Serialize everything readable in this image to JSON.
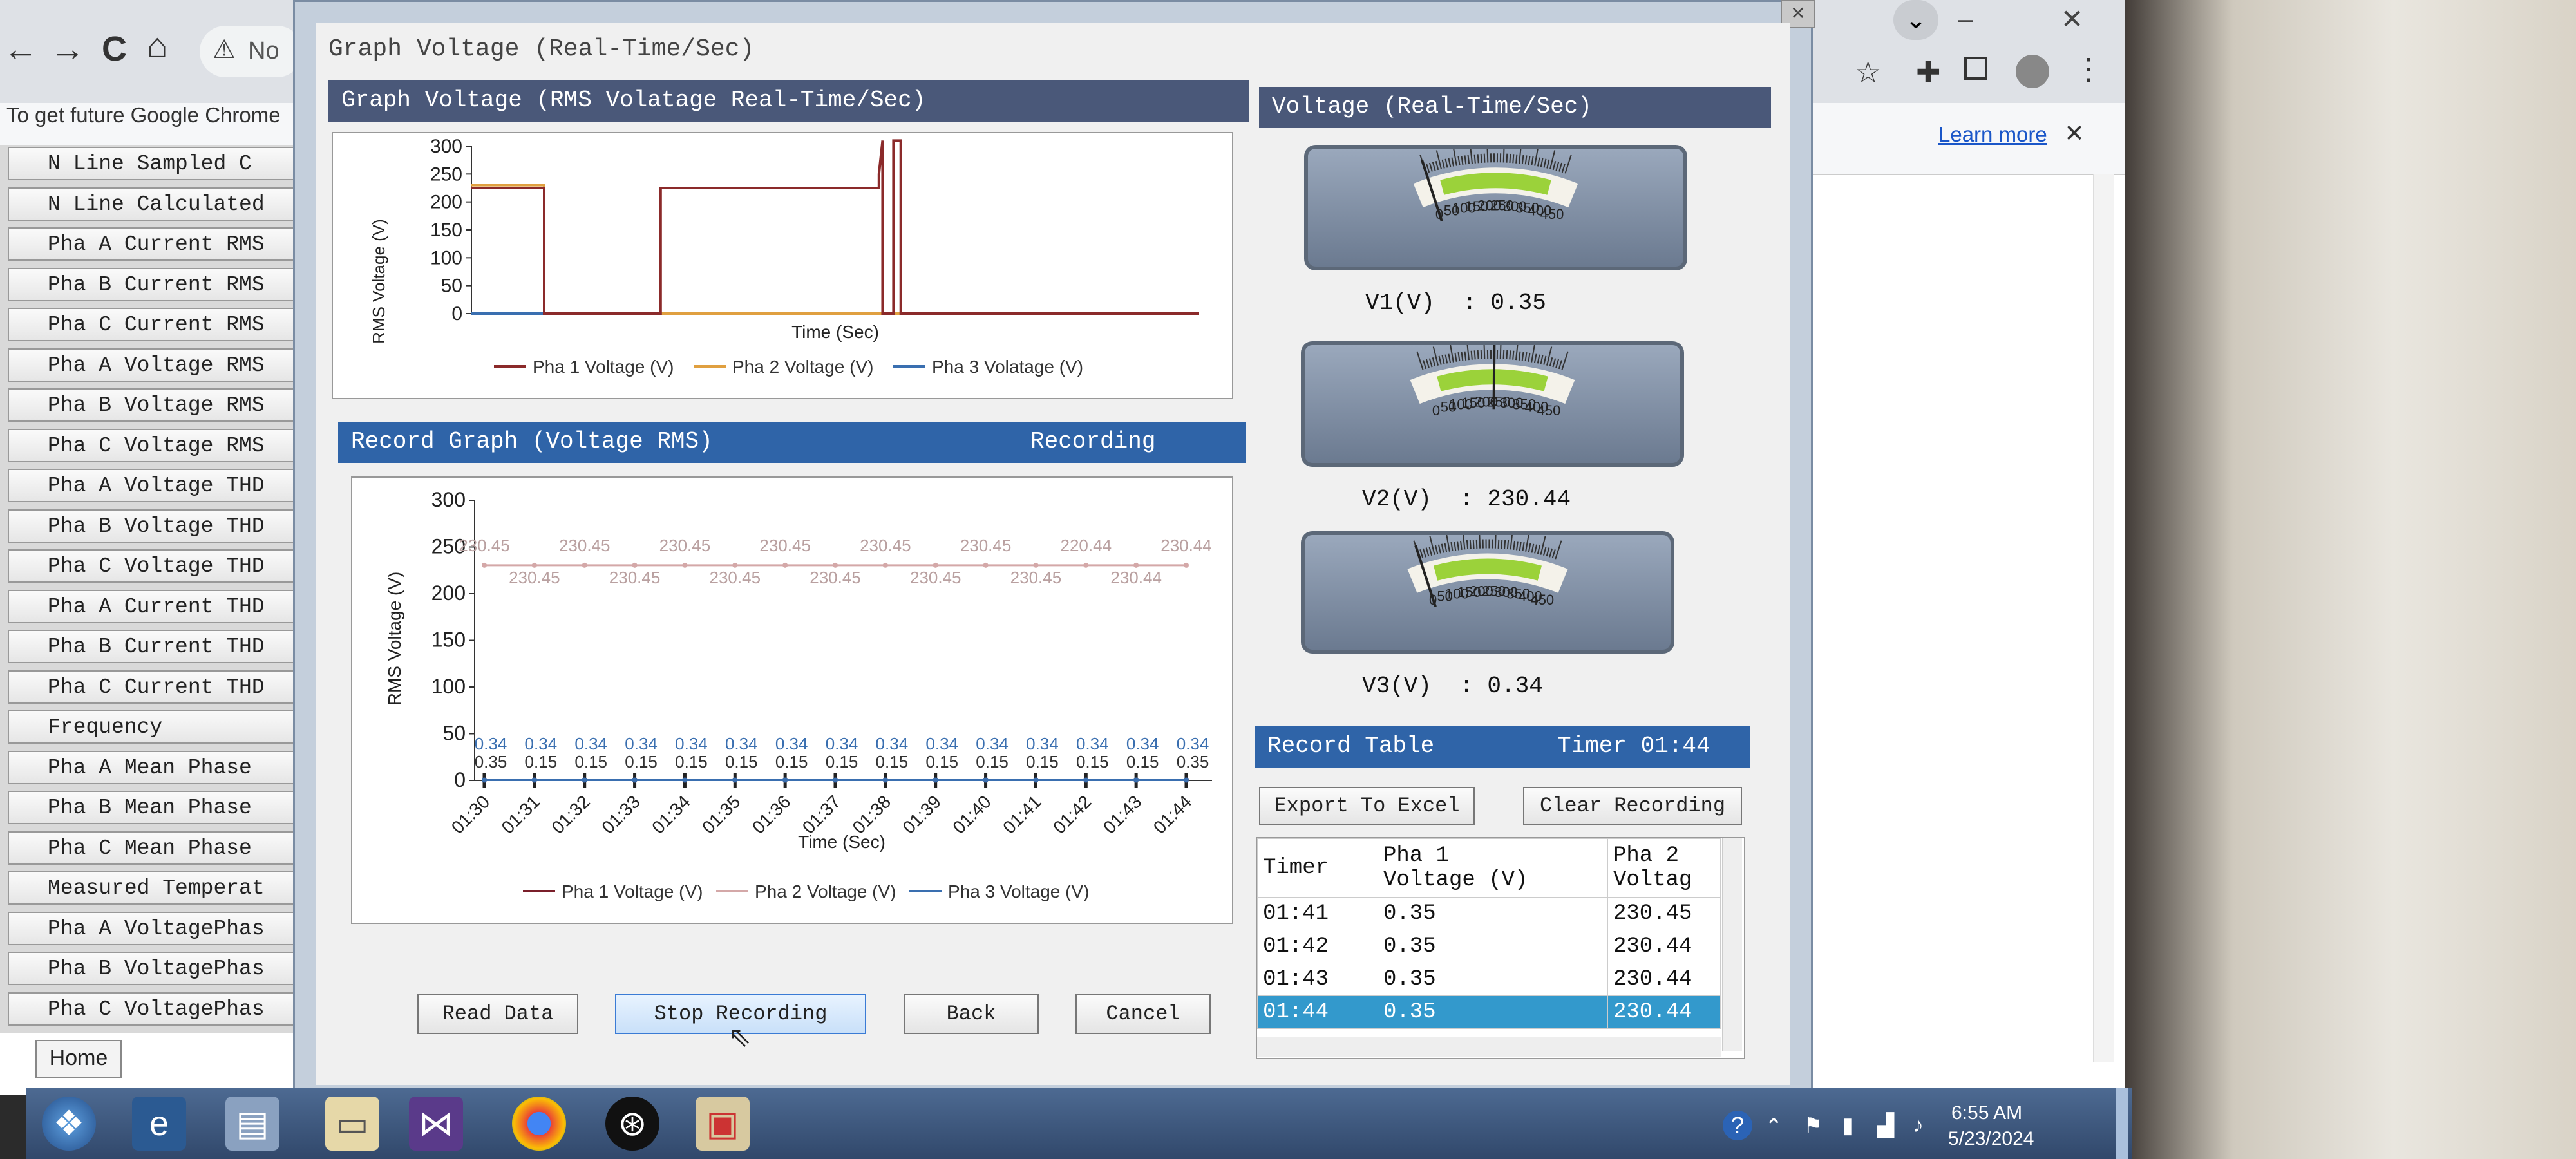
{
  "browser": {
    "nav": {
      "back": "←",
      "forward": "→",
      "reload": "C",
      "home": "⌂"
    },
    "address_prefix": "No",
    "infobar_text": "To get future Google Chrome",
    "learn_more": "Learn more",
    "close": "✕"
  },
  "app_list": {
    "items": [
      "N Line Sampled C",
      "N Line Calculated",
      "Pha A Current RMS",
      "Pha B Current RMS",
      "Pha C Current RMS",
      "Pha A Voltage RMS",
      "Pha B Voltage RMS",
      "Pha C Voltage RMS",
      "Pha A Voltage THD",
      "Pha B Voltage THD",
      "Pha C Voltage THD",
      "Pha A Current THD",
      "Pha B Current THD",
      "Pha C Current THD",
      "Frequency",
      "Pha A Mean Phase",
      "Pha B Mean Phase",
      "Pha C Mean Phase",
      "Measured Temperat",
      "Pha A VoltagePhas",
      "Pha B VoltagePhas",
      "Pha C VoltagePhas"
    ],
    "home_button": "Home"
  },
  "dialog": {
    "group_title": "Graph Voltage (Real-Time/Sec)",
    "close_glyph": "✕",
    "live_chart_header": "Graph Voltage (RMS Volatage Real-Time/Sec)",
    "record_header": "Record Graph (Voltage RMS)",
    "record_status": "Recording",
    "gauges_header": "Voltage (Real-Time/Sec)",
    "gauges": [
      {
        "label": "V1(V)  : 0.35",
        "value": 0.35
      },
      {
        "label": "V2(V)  : 230.44",
        "value": 230.44
      },
      {
        "label": "V3(V)  : 0.34",
        "value": 0.34
      }
    ],
    "gauge_scale": [
      "0",
      "50",
      "100",
      "150",
      "200",
      "250",
      "300",
      "350",
      "400",
      "450"
    ],
    "record_table_header": "Record Table",
    "timer_label": "Timer 01:44",
    "export_button": "Export To Excel",
    "clear_button": "Clear Recording",
    "table": {
      "headers": [
        "Timer",
        "Pha 1\nVoltage (V)",
        "Pha 2\nVoltag"
      ],
      "rows": [
        [
          "01:41",
          "0.35",
          "230.45"
        ],
        [
          "01:42",
          "0.35",
          "230.44"
        ],
        [
          "01:43",
          "0.35",
          "230.44"
        ],
        [
          "01:44",
          "0.35",
          "230.44"
        ]
      ],
      "selected_row": 3
    },
    "buttons": {
      "read": "Read Data",
      "stop": "Stop Recording",
      "back": "Back",
      "cancel": "Cancel"
    }
  },
  "taskbar": {
    "time": "6:55 AM",
    "date": "5/23/2024",
    "help": "?",
    "tray_up": "⌃"
  },
  "chart_data": [
    {
      "type": "line",
      "xlabel": "Time (Sec)",
      "ylabel": "RMS Voltage (V)",
      "ylim": [
        0,
        300
      ],
      "yticks": [
        "0",
        "50",
        "100",
        "150",
        "200",
        "250",
        "300"
      ],
      "series": [
        {
          "name": "Pha 1 Voltage (V)",
          "color": "#8b2a2a",
          "points": [
            [
              0,
              225
            ],
            [
              0.1,
              225
            ],
            [
              0.1,
              0
            ],
            [
              0.26,
              0
            ],
            [
              0.26,
              225
            ],
            [
              0.56,
              225
            ],
            [
              0.56,
              250
            ],
            [
              0.565,
              310
            ],
            [
              0.565,
              0
            ],
            [
              0.58,
              0
            ],
            [
              0.58,
              310
            ],
            [
              0.59,
              310
            ],
            [
              0.59,
              0
            ],
            [
              1,
              0
            ]
          ]
        },
        {
          "name": "Pha 2 Voltage (V)",
          "color": "#e0a040",
          "points": [
            [
              0,
              230
            ],
            [
              0.1,
              230
            ],
            [
              0.1,
              0
            ],
            [
              1,
              0
            ]
          ]
        },
        {
          "name": "Pha 3 Volatage (V)",
          "color": "#3a6fb0",
          "points": [
            [
              0,
              0
            ],
            [
              1,
              0
            ]
          ]
        }
      ],
      "legend": "bottom"
    },
    {
      "type": "line",
      "xlabel": "Time (Sec)",
      "ylabel": "RMS Voltage (V)",
      "ylim": [
        0,
        300
      ],
      "yticks": [
        "0",
        "50",
        "100",
        "150",
        "200",
        "250",
        "300"
      ],
      "categories": [
        "01:30",
        "01:31",
        "01:32",
        "01:33",
        "01:34",
        "01:35",
        "01:36",
        "01:37",
        "01:38",
        "01:39",
        "01:40",
        "01:41",
        "01:42",
        "01:43",
        "01:44"
      ],
      "series": [
        {
          "name": "Pha 1 Voltage (V)",
          "color": "#7a1f2a",
          "values": [
            0.35,
            0.35,
            0.35,
            0.35,
            0.35,
            0.35,
            0.35,
            0.35,
            0.35,
            0.35,
            0.35,
            0.35,
            0.35,
            0.35,
            0.35
          ]
        },
        {
          "name": "Pha 2 Voltage (V)",
          "color": "#d4a8a8",
          "values": [
            230.45,
            230.45,
            230.45,
            230.45,
            230.45,
            230.45,
            230.45,
            230.45,
            230.45,
            230.45,
            230.45,
            230.45,
            230.45,
            230.44,
            230.44
          ]
        },
        {
          "name": "Pha 3 Voltage (V)",
          "color": "#3a6fb0",
          "values": [
            0.34,
            0.34,
            0.34,
            0.34,
            0.34,
            0.34,
            0.34,
            0.34,
            0.34,
            0.34,
            0.34,
            0.34,
            0.34,
            0.34,
            0.34
          ]
        }
      ],
      "pha2_labels": [
        "230.45",
        "230.45",
        "230.45",
        "230.45",
        "230.45",
        "230.45",
        "230.45",
        "230.45",
        "230.45",
        "230.45",
        "230.45",
        "230.45",
        "220.44",
        "230.44",
        "230.44"
      ],
      "pha1_labels": [
        "0.35",
        "0.15",
        "0.15",
        "0.15",
        "0.15",
        "0.15",
        "0.15",
        "0.15",
        "0.15",
        "0.15",
        "0.15",
        "0.15",
        "0.15",
        "0.15",
        "0.35"
      ],
      "pha3_labels": [
        "0.34",
        "0.34",
        "0.34",
        "0.34",
        "0.34",
        "0.34",
        "0.34",
        "0.34",
        "0.34",
        "0.34",
        "0.34",
        "0.34",
        "0.34",
        "0.34",
        "0.34"
      ],
      "legend": "bottom"
    }
  ]
}
